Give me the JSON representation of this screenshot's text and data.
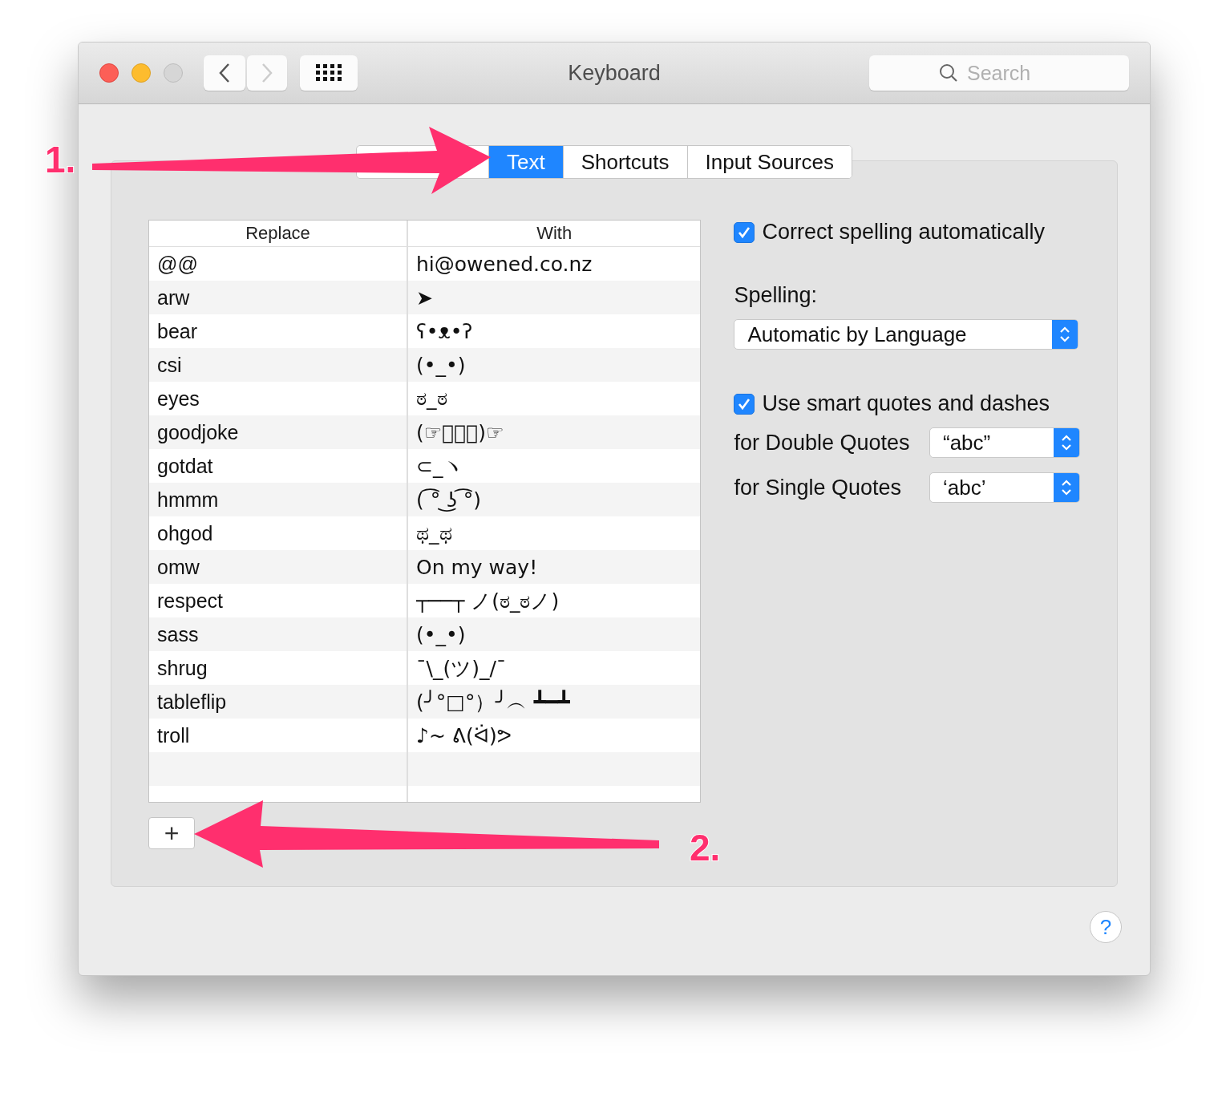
{
  "window": {
    "title": "Keyboard"
  },
  "search": {
    "placeholder": "Search"
  },
  "tabs": [
    {
      "label": "Text",
      "selected": true
    },
    {
      "label": "Shortcuts",
      "selected": false
    },
    {
      "label": "Input Sources",
      "selected": false
    }
  ],
  "table": {
    "columns": [
      "Replace",
      "With"
    ],
    "rows": [
      {
        "replace": "@@",
        "with": "hi@owened.co.nz"
      },
      {
        "replace": "arw",
        "with": "➤"
      },
      {
        "replace": "bear",
        "with": "ʕ•ᴥ•ʔ"
      },
      {
        "replace": "csi",
        "with": "(•_•)"
      },
      {
        "replace": "eyes",
        "with": "ಠ_ಠ"
      },
      {
        "replace": "goodjoke",
        "with": "(☞ﾟヮﾟ)☞"
      },
      {
        "replace": "gotdat",
        "with": "⊂_ヽ"
      },
      {
        "replace": "hmmm",
        "with": "( ͡° ͜ʖ ͡°)"
      },
      {
        "replace": "ohgod",
        "with": "ಥ_ಥ"
      },
      {
        "replace": "omw",
        "with": "On my way!"
      },
      {
        "replace": "respect",
        "with": "┬──┬ ノ(ಠ_ಠノ)"
      },
      {
        "replace": "sass",
        "with": "(•_•)"
      },
      {
        "replace": "shrug",
        "with": "¯\\_(ツ)_/¯"
      },
      {
        "replace": "tableflip",
        "with": "(╯°□°）╯︵ ┻━┻"
      },
      {
        "replace": "troll",
        "with": "♪~ ᕕ(ᐛ)ᕗ"
      }
    ]
  },
  "add_button": {
    "label": "+"
  },
  "settings": [
    {
      "kind": "checkbox",
      "label": "Correct spelling automatically",
      "checked": true
    },
    {
      "kind": "heading",
      "label": "Spelling:"
    },
    {
      "kind": "popup",
      "value": "Automatic by Language"
    },
    {
      "kind": "checkbox",
      "label": "Use smart quotes and dashes",
      "checked": true
    },
    {
      "kind": "labeled_popup",
      "label": "for Double Quotes",
      "value": "“abc”"
    },
    {
      "kind": "labeled_popup",
      "label": "for Single Quotes",
      "value": "‘abc’"
    }
  ],
  "help_button": {
    "label": "?"
  },
  "annotations": [
    {
      "label": "1."
    },
    {
      "label": "2."
    }
  ]
}
